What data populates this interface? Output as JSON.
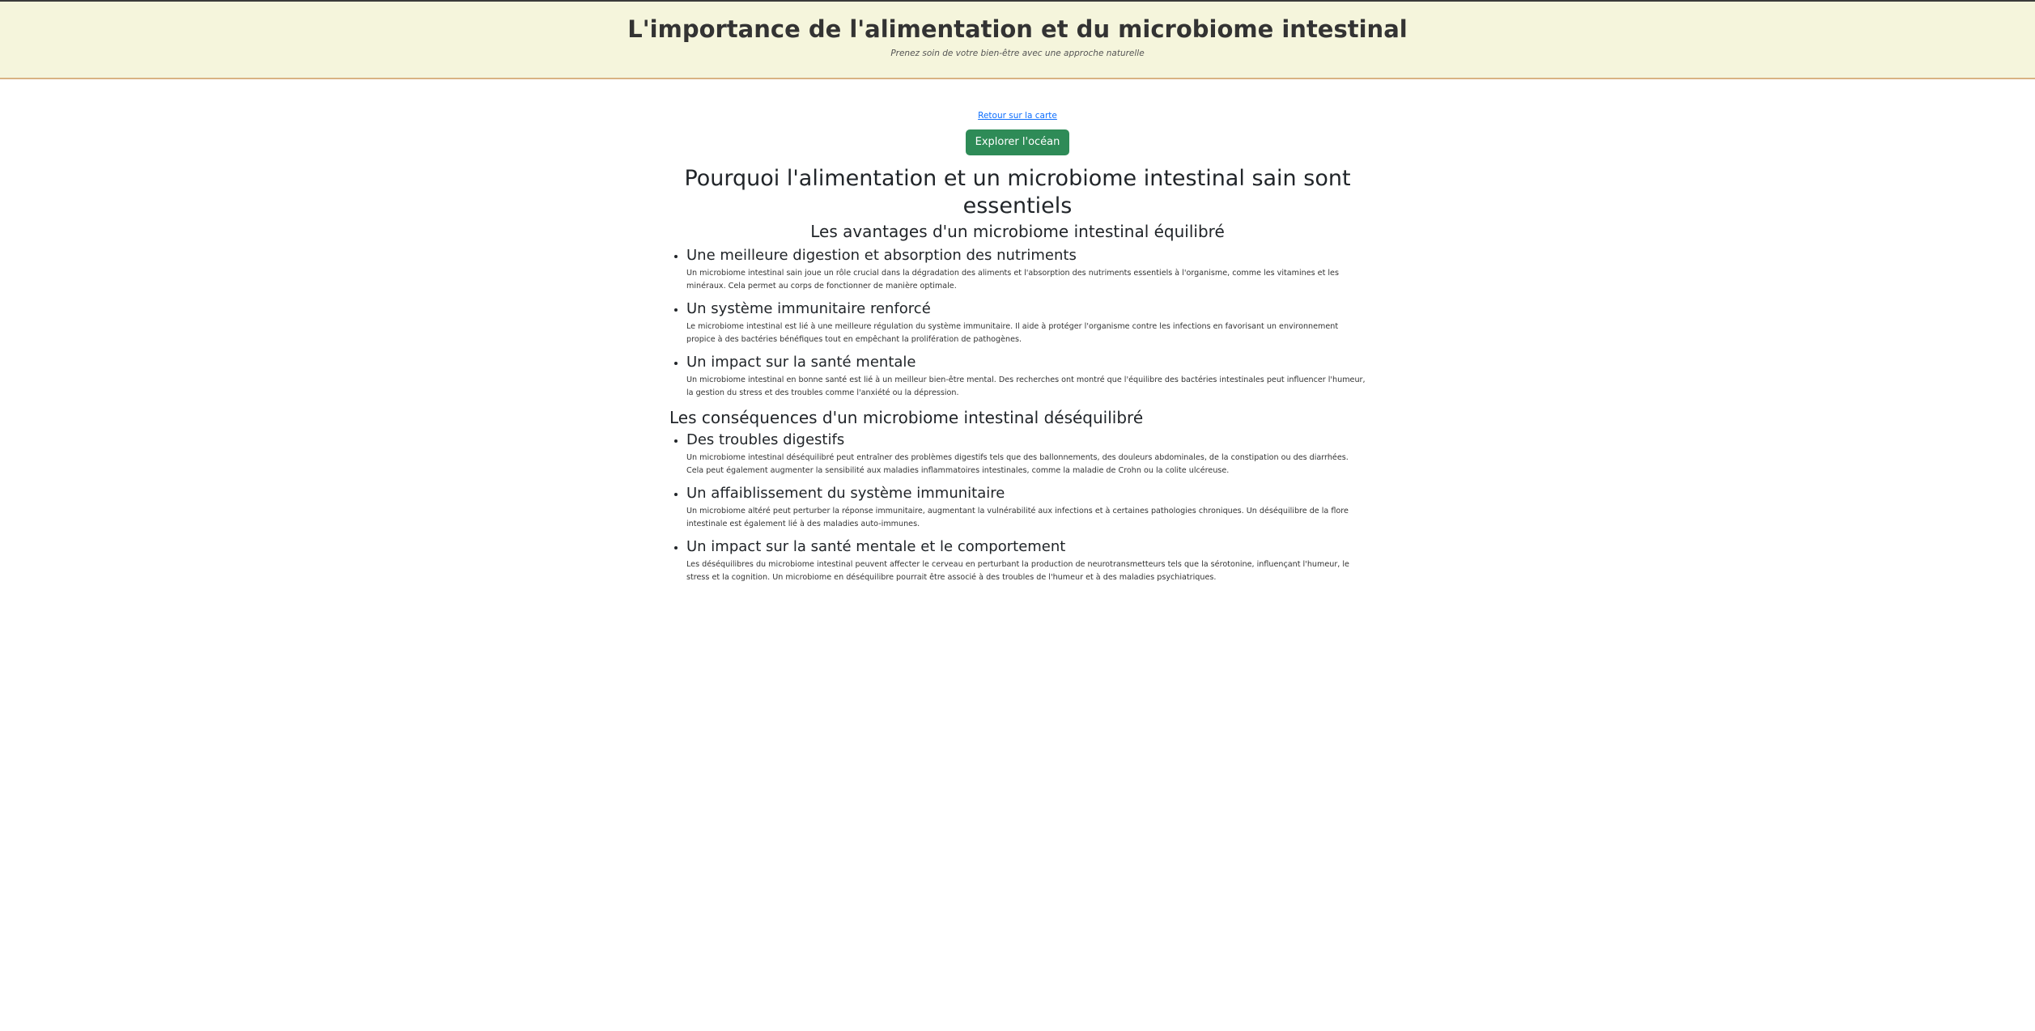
{
  "header": {
    "title": "L'importance de l'alimentation et du microbiome intestinal",
    "subtitle": "Prenez soin de votre bien-être avec une approche naturelle"
  },
  "nav": {
    "back_link": "Retour sur la carte",
    "explore_button": "Explorer l'océan"
  },
  "main": {
    "heading": "Pourquoi l'alimentation et un microbiome intestinal sain sont essentiels",
    "benefits": {
      "heading": "Les avantages d'un microbiome intestinal équilibré",
      "items": [
        {
          "title": "Une meilleure digestion et absorption des nutriments",
          "text": "Un microbiome intestinal sain joue un rôle crucial dans la dégradation des aliments et l'absorption des nutriments essentiels à l'organisme, comme les vitamines et les minéraux. Cela permet au corps de fonctionner de manière optimale."
        },
        {
          "title": "Un système immunitaire renforcé",
          "text": "Le microbiome intestinal est lié à une meilleure régulation du système immunitaire. Il aide à protéger l'organisme contre les infections en favorisant un environnement propice à des bactéries bénéfiques tout en empêchant la prolifération de pathogènes."
        },
        {
          "title": "Un impact sur la santé mentale",
          "text": "Un microbiome intestinal en bonne santé est lié à un meilleur bien-être mental. Des recherches ont montré que l'équilibre des bactéries intestinales peut influencer l'humeur, la gestion du stress et des troubles comme l'anxiété ou la dépression."
        }
      ]
    },
    "consequences": {
      "heading": "Les conséquences d'un microbiome intestinal déséquilibré",
      "items": [
        {
          "title": "Des troubles digestifs",
          "text": "Un microbiome intestinal déséquilibré peut entraîner des problèmes digestifs tels que des ballonnements, des douleurs abdominales, de la constipation ou des diarrhées. Cela peut également augmenter la sensibilité aux maladies inflammatoires intestinales, comme la maladie de Crohn ou la colite ulcéreuse."
        },
        {
          "title": "Un affaiblissement du système immunitaire",
          "text": "Un microbiome altéré peut perturber la réponse immunitaire, augmentant la vulnérabilité aux infections et à certaines pathologies chroniques. Un déséquilibre de la flore intestinale est également lié à des maladies auto-immunes."
        },
        {
          "title": "Un impact sur la santé mentale et le comportement",
          "text": "Les déséquilibres du microbiome intestinal peuvent affecter le cerveau en perturbant la production de neurotransmetteurs tels que la sérotonine, influençant l'humeur, le stress et la cognition. Un microbiome en déséquilibre pourrait être associé à des troubles de l'humeur et à des maladies psychiatriques."
        }
      ]
    }
  },
  "colors": {
    "header_bg": "#f5f5dc",
    "header_border": "#d9b382",
    "button_bg": "#2e8b57",
    "link": "#0d6efd"
  }
}
